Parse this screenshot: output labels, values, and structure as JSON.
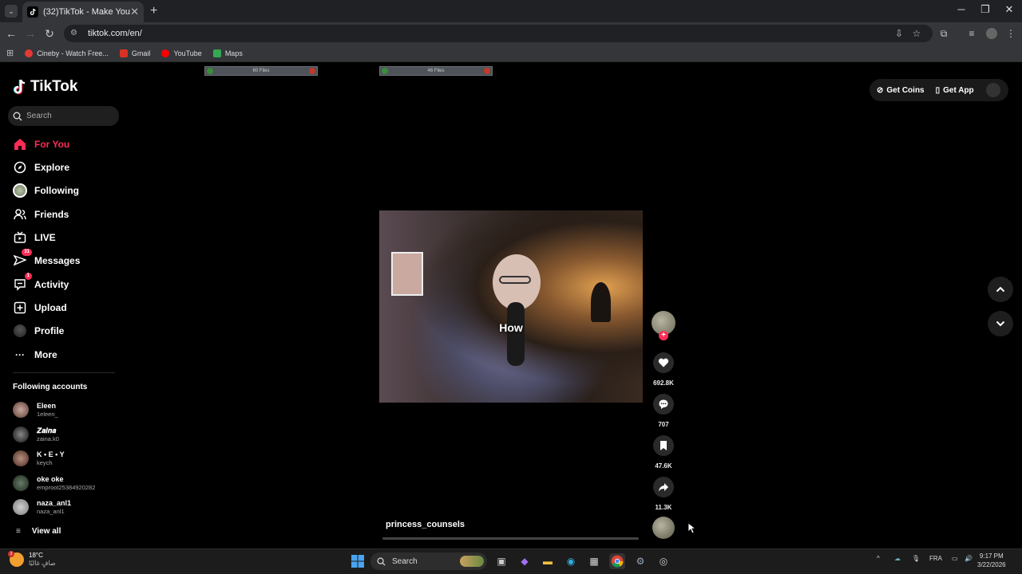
{
  "browser": {
    "tab_title": "(32)TikTok - Make Your Day",
    "url": "tiktok.com/en/",
    "bookmarks": [
      {
        "label": "Cineby - Watch Free...",
        "color": "#e53935"
      },
      {
        "label": "Gmail",
        "color": "#d93025"
      },
      {
        "label": "YouTube",
        "color": "#ff0000"
      },
      {
        "label": "Maps",
        "color": "#34a853"
      }
    ]
  },
  "overlay": {
    "file_bar_1": "60 Files",
    "file_bar_2": "46 Files"
  },
  "tiktok": {
    "logo_text": "TikTok",
    "search_placeholder": "Search",
    "nav": [
      {
        "label": "For You",
        "icon": "home-icon",
        "active": true
      },
      {
        "label": "Explore",
        "icon": "compass-icon"
      },
      {
        "label": "Following",
        "icon": "following-avatar-icon"
      },
      {
        "label": "Friends",
        "icon": "friends-icon"
      },
      {
        "label": "LIVE",
        "icon": "live-icon"
      },
      {
        "label": "Messages",
        "icon": "messages-icon",
        "badge": "31"
      },
      {
        "label": "Activity",
        "icon": "activity-icon",
        "badge": "1"
      },
      {
        "label": "Upload",
        "icon": "upload-icon"
      },
      {
        "label": "Profile",
        "icon": "profile-icon"
      },
      {
        "label": "More",
        "icon": "more-icon"
      }
    ],
    "following_heading": "Following accounts",
    "accounts": [
      {
        "name": "Eleen",
        "handle": "1eleen_"
      },
      {
        "name": "𝒁𝒂𝒊𝒏𝒂",
        "handle": "zaina.k0"
      },
      {
        "name": "K • E • Y",
        "handle": "keych"
      },
      {
        "name": "oke oke",
        "handle": "emproot25384920282"
      },
      {
        "name": "naza_anl1",
        "handle": "naza_anl1"
      }
    ],
    "view_all": "View all",
    "get_coins": "Get Coins",
    "get_app": "Get App",
    "video": {
      "caption": "How",
      "username": "princess_counsels",
      "likes": "692.8K",
      "comments": "707",
      "saves": "47.6K",
      "shares": "11.3K",
      "progress_percent": 0
    },
    "accent": "#fe2c55"
  },
  "taskbar": {
    "weather_temp": "18°C",
    "weather_desc": "صافٍ غالبًا",
    "search_label": "Search",
    "language": "FRA",
    "time": "9:17 PM",
    "date": "3/22/2026"
  }
}
